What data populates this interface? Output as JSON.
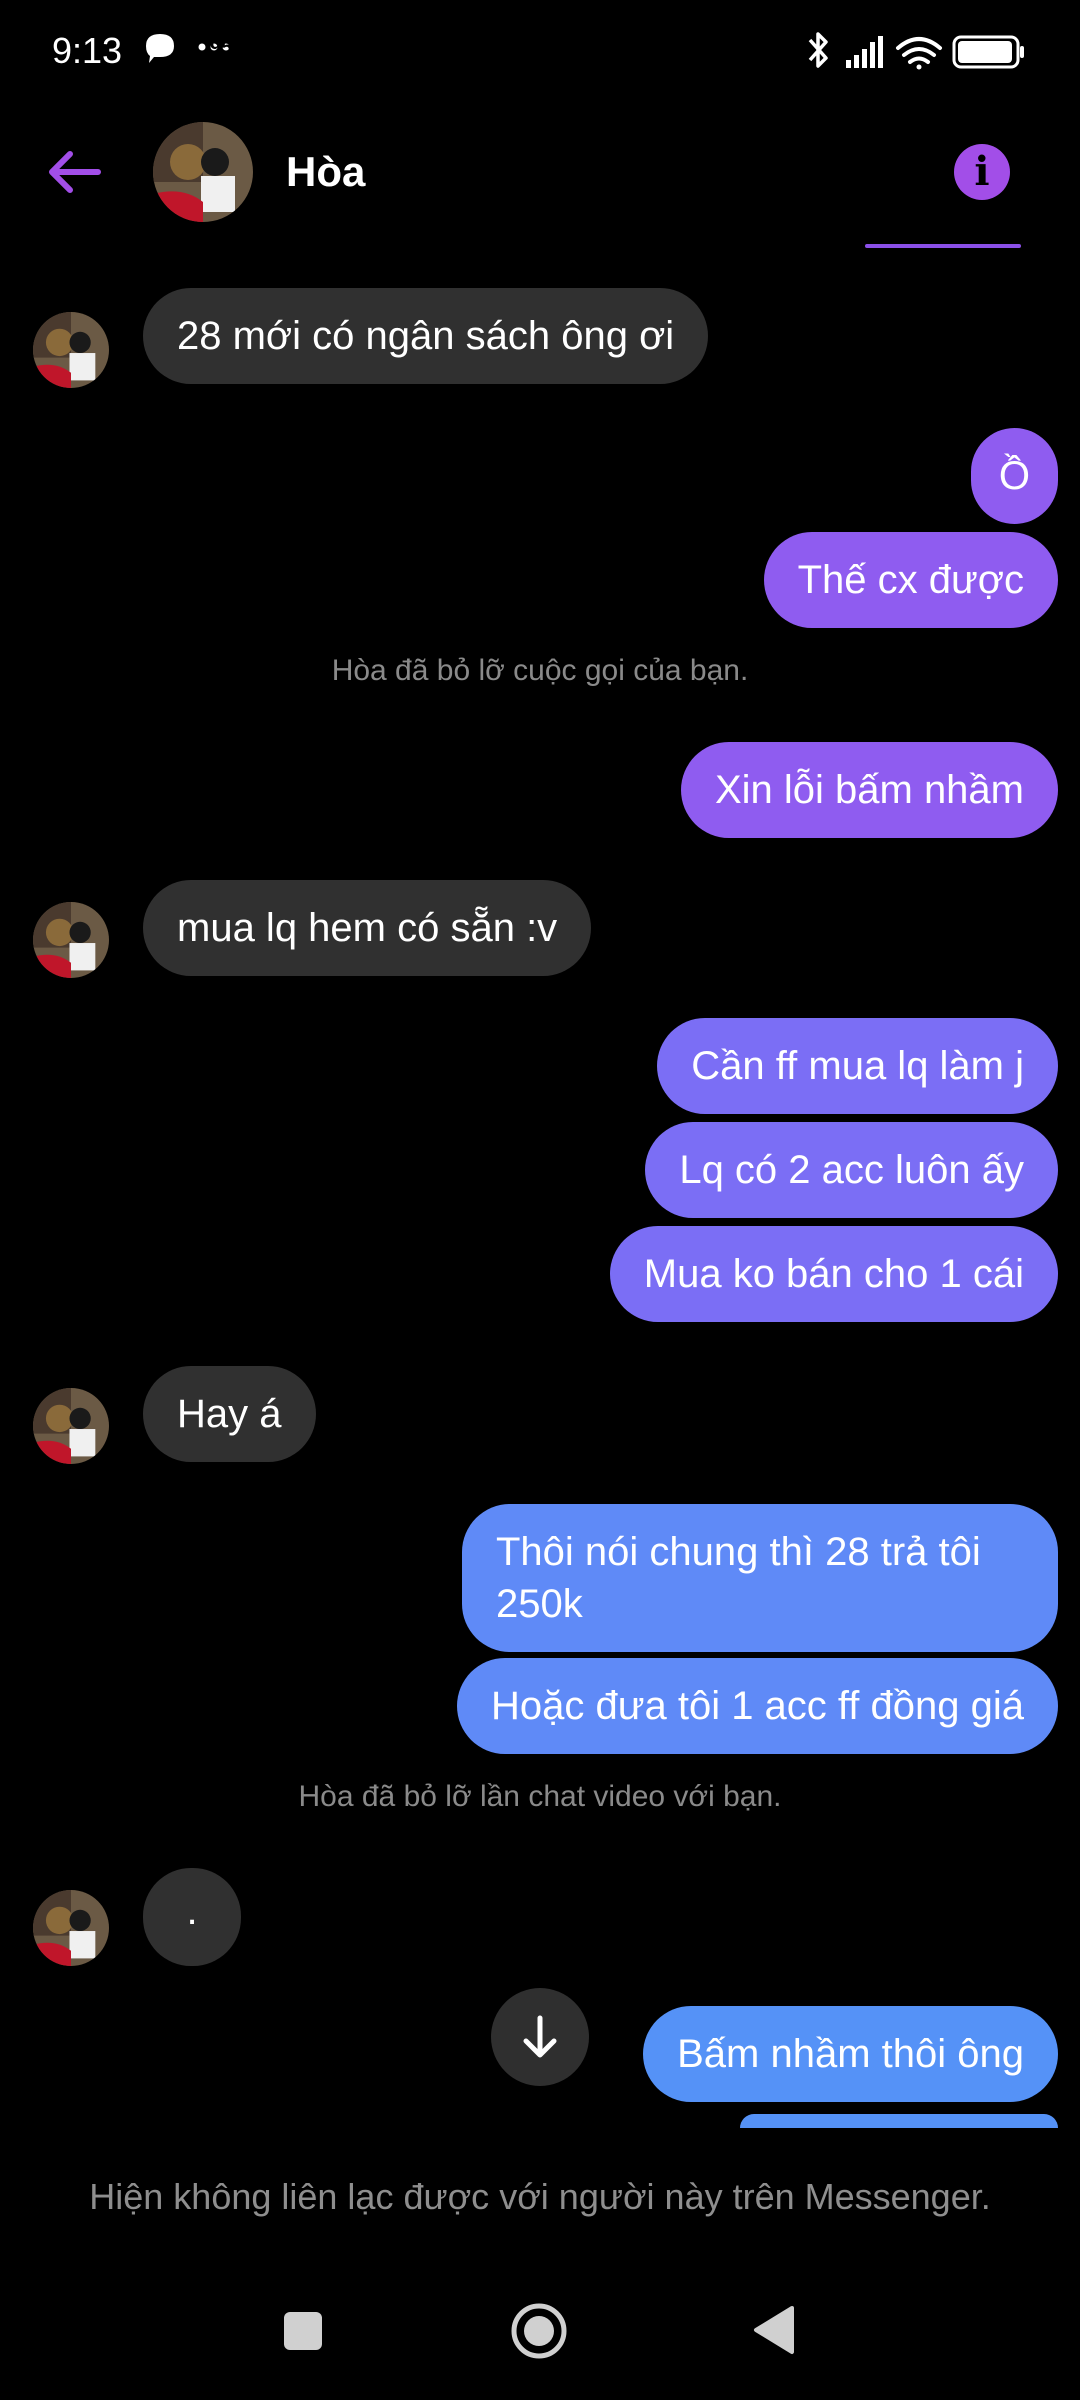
{
  "status_bar": {
    "time": "9:13",
    "battery": "95",
    "icons": [
      "chat-bubble-icon",
      "more-dots-icon",
      "bluetooth-icon",
      "signal-icon",
      "wifi-icon",
      "battery-icon"
    ]
  },
  "header": {
    "contact_name": "Hòa",
    "back_icon": "back-arrow-icon",
    "info_icon": "info-icon",
    "info_glyph": "i"
  },
  "messages": [
    {
      "side": "in",
      "text": "28 mới có ngân sách ông ơi"
    },
    {
      "side": "out",
      "text": "Ồ"
    },
    {
      "side": "out",
      "text": "Thế cx được"
    },
    {
      "side": "system",
      "text": "Hòa đã bỏ lỡ cuộc gọi của bạn."
    },
    {
      "side": "out",
      "text": "Xin lỗi bấm nhầm"
    },
    {
      "side": "in",
      "text": "mua lq hem có sẵn :v"
    },
    {
      "side": "out",
      "text": "Cần ff mua lq làm j"
    },
    {
      "side": "out",
      "text": "Lq có 2 acc luôn ấy"
    },
    {
      "side": "out",
      "text": "Mua ko bán cho 1 cái"
    },
    {
      "side": "in",
      "text": "Hay á"
    },
    {
      "side": "out",
      "text": "Thôi nói chung thì 28 trả tôi 250k"
    },
    {
      "side": "out",
      "text": "Hoặc đưa tôi 1 acc ff đồng giá"
    },
    {
      "side": "system",
      "text": "Hòa đã bỏ lỡ lần chat video với bạn."
    },
    {
      "side": "in",
      "text": "."
    },
    {
      "side": "out",
      "text": "Bấm nhầm thôi ông"
    }
  ],
  "footer": {
    "notice": "Hiện không liên lạc được với người này trên Messenger."
  },
  "colors": {
    "accent": "#a24ee8",
    "incoming_bubble": "#303030",
    "outgoing_purple": "#8f5cf0",
    "outgoing_blue": "#5f8af7"
  }
}
